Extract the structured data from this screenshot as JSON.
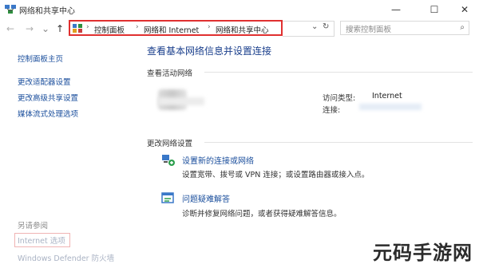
{
  "window": {
    "title": "网络和共享中心",
    "minimize": "—",
    "maximize": "☐",
    "close": "✕"
  },
  "addressbar": {
    "back": "←",
    "forward": "→",
    "up": "↑",
    "crumbs": [
      "控制面板",
      "Internet",
      "网络和共享中心"
    ],
    "crumb_prefix_network": "网络和",
    "separator": "›",
    "dropdown": "⌄",
    "refresh": "↻",
    "search_placeholder": "搜索控制面板",
    "search_icon": "⌕"
  },
  "sidebar": {
    "items": [
      "控制面板主页",
      "更改适配器设置",
      "更改高级共享设置",
      "媒体流式处理选项"
    ],
    "see_also_label": "另请参阅",
    "see_also": [
      "Internet 选项",
      "Windows Defender 防火墙"
    ]
  },
  "main": {
    "heading": "查看基本网络信息并设置连接",
    "active_networks_label": "查看活动网络",
    "access_type_label": "访问类型:",
    "access_type_value": "Internet",
    "connections_label": "连接:",
    "change_settings_label": "更改网络设置",
    "tasks": [
      {
        "title": "设置新的连接或网络",
        "desc": "设置宽带、拨号或 VPN 连接；或设置路由器或接入点。",
        "icon": "network-setup-icon"
      },
      {
        "title": "问题疑难解答",
        "desc": "诊断并修复网络问题，或者获得疑难解答信息。",
        "icon": "troubleshoot-icon"
      }
    ]
  },
  "watermark": "元码手游网",
  "colors": {
    "link": "#1a4e9c",
    "heading": "#1a3f8c",
    "highlight": "#e03030"
  }
}
